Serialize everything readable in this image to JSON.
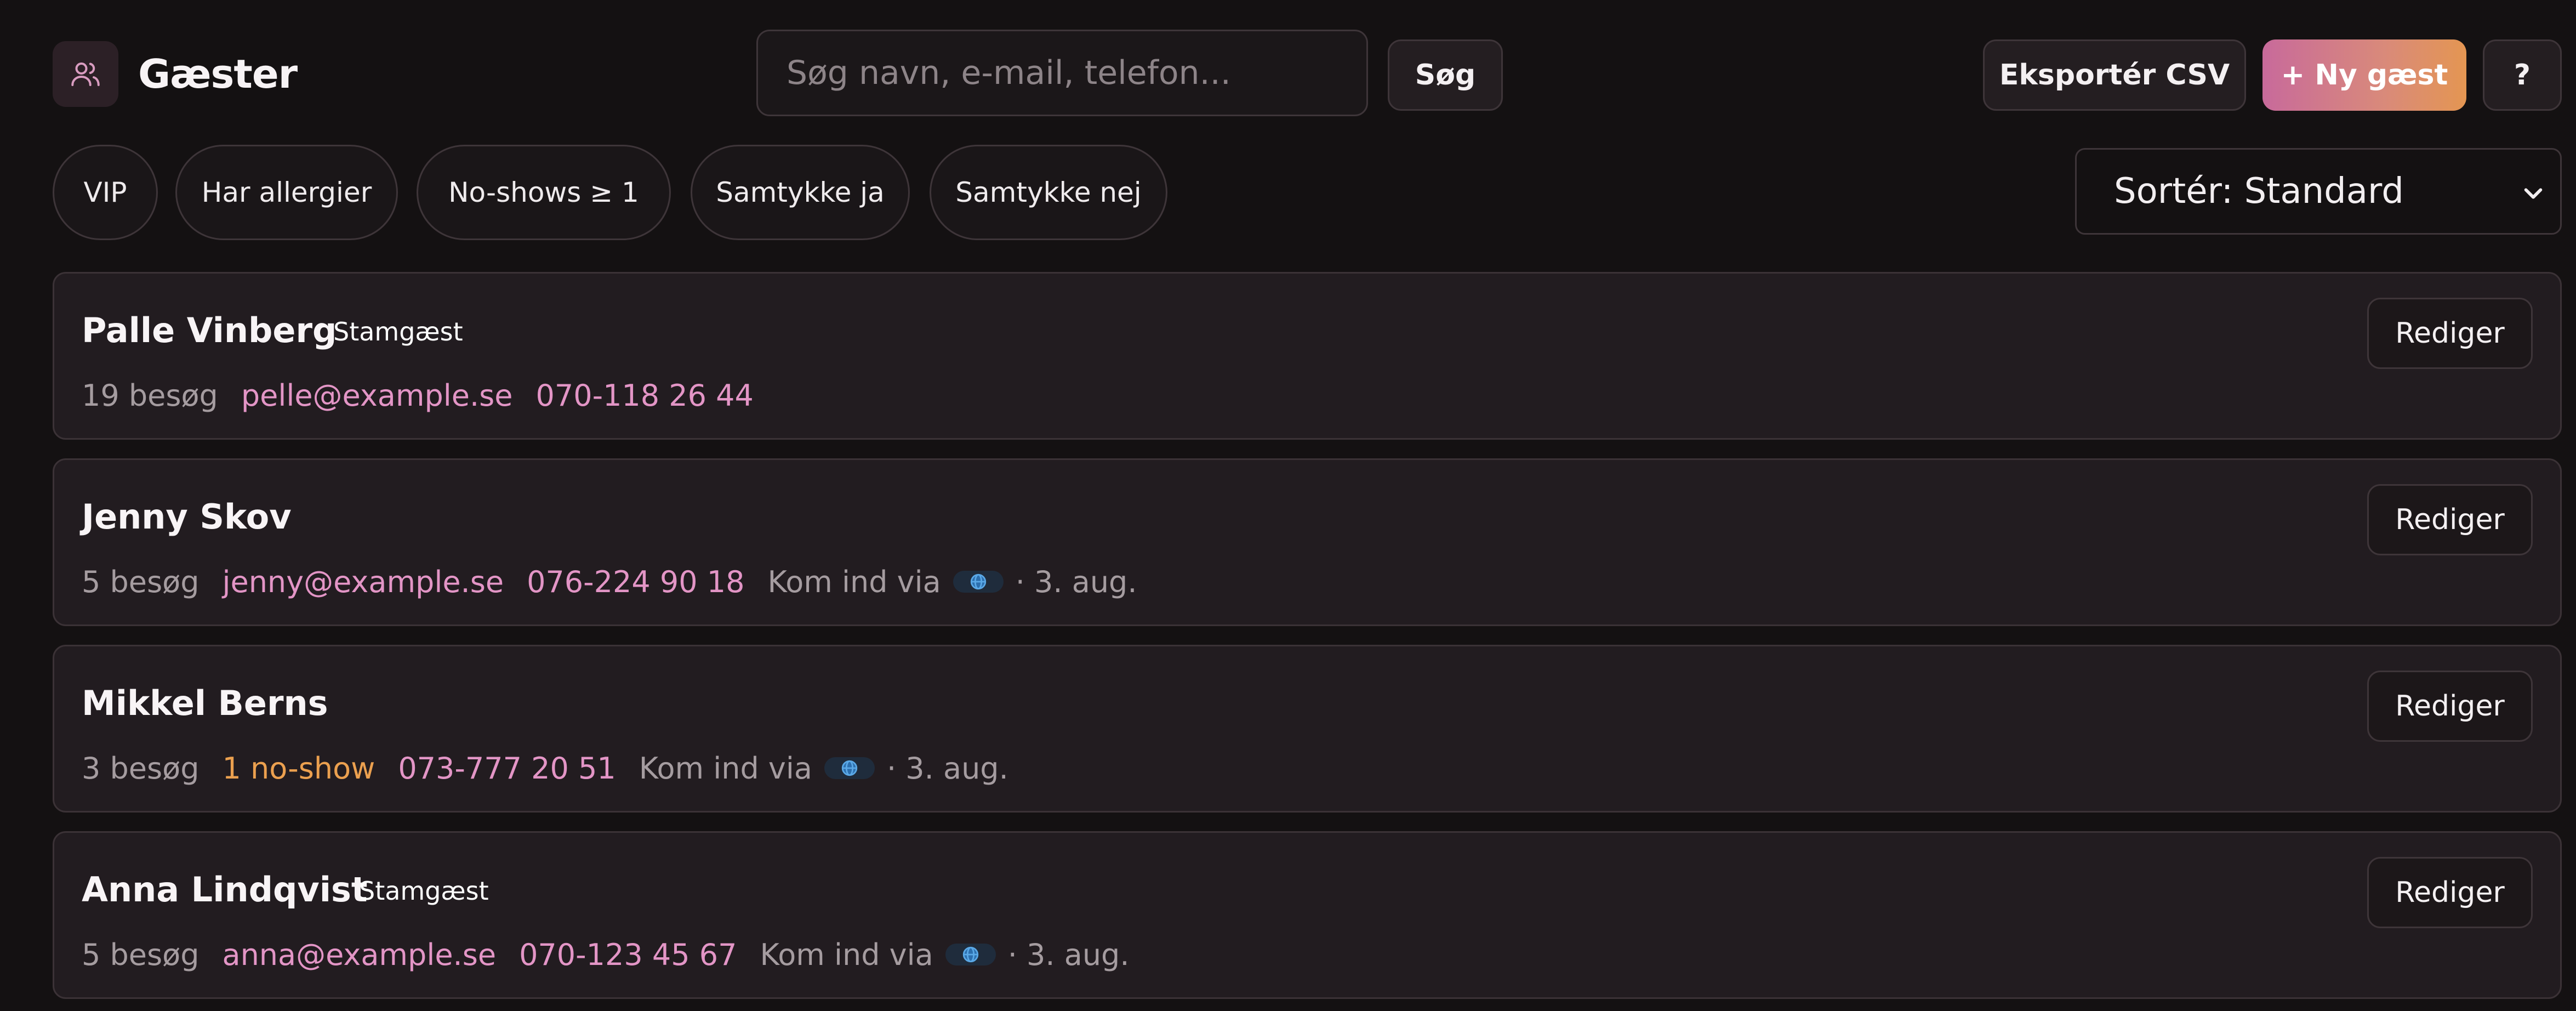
{
  "header": {
    "title": "Gæster",
    "search_placeholder": "Søg navn, e-mail, telefon...",
    "search_label": "Søg",
    "export_label": "Eksportér CSV",
    "new_guest_label": "+ Ny gæst",
    "help_label": "?"
  },
  "filters": {
    "chips": [
      "VIP",
      "Har allergier",
      "No-shows ≥ 1",
      "Samtykke ja",
      "Samtykke nej"
    ],
    "sort_value": "Sortér: Standard"
  },
  "guests": [
    {
      "name": "Palle Vinberg",
      "tag": "Stamgæst",
      "visits": "19 besøg",
      "email": "pelle@example.se",
      "phone": "070-118 26 44"
    },
    {
      "name": "Jenny Skov",
      "visits": "5 besøg",
      "email": "jenny@example.se",
      "phone": "076-224 90 18",
      "via": "Kom ind via",
      "date": "· 3. aug."
    },
    {
      "name": "Mikkel Berns",
      "visits": "3 besøg",
      "noshow": "1 no-show",
      "phone": "073-777 20 51",
      "via": "Kom ind via",
      "date": "· 3. aug."
    },
    {
      "name": "Anna Lindqvist",
      "tag": "Stamgæst",
      "visits": "5 besøg",
      "email": "anna@example.se",
      "phone": "070-123 45 67",
      "via": "Kom ind via",
      "date": "· 3. aug."
    }
  ],
  "edit_label": "Rediger",
  "icons": {
    "app": "users-icon",
    "sort": "chevron-down-icon",
    "source": "globe-icon"
  },
  "colors": {
    "background": "#141112",
    "card": "#221c20",
    "accent_pink": "#e395c6",
    "accent_orange": "#eba04f",
    "gradient_start": "#c86a9b",
    "gradient_end": "#e49652"
  }
}
